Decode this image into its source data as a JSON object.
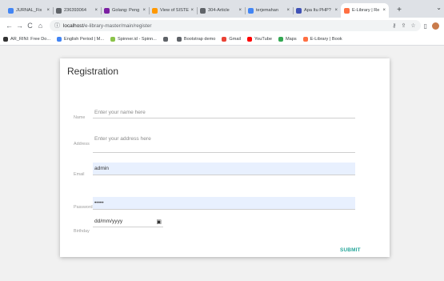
{
  "browser": {
    "tabs": [
      {
        "title": "JURNAL_Fix",
        "color": "#4285f4"
      },
      {
        "title": "236393064",
        "color": "#5f6368"
      },
      {
        "title": "Golang: Peng",
        "color": "#7b1fa2"
      },
      {
        "title": "View of SISTE",
        "color": "#ff9800"
      },
      {
        "title": "304-Article",
        "color": "#5f6368"
      },
      {
        "title": "terjemahan",
        "color": "#4285f4"
      },
      {
        "title": "Apa Itu PHP?",
        "color": "#3f51b5"
      },
      {
        "title": "E-Library | Re",
        "color": "#ff7043",
        "active": true
      }
    ],
    "close_glyph": "×",
    "new_tab_glyph": "+",
    "tab_search_glyph": "⌄",
    "url_host": "localhost",
    "url_path": "/e-library-master/main/register",
    "nav": {
      "back": "←",
      "forward": "→",
      "reload": "C",
      "home": "⌂"
    },
    "omni_icons": {
      "info": "ⓘ",
      "key": "⚷",
      "share": "⇪",
      "star": "☆"
    },
    "toolbar_icons": {
      "sidebar": "▯"
    },
    "bookmarks": [
      {
        "title": "AR_RINI: Free Do...",
        "color": "#333333"
      },
      {
        "title": "English Period | M...",
        "color": "#4285f4"
      },
      {
        "title": "Spinner.id - Spinn...",
        "color": "#8bc34a"
      },
      {
        "title": "",
        "color": "#5f6368"
      },
      {
        "title": "Bootstrap demo",
        "color": "#5f6368"
      },
      {
        "title": "Gmail",
        "color": "#ea4335"
      },
      {
        "title": "YouTube",
        "color": "#ff0000"
      },
      {
        "title": "Maps",
        "color": "#34a853"
      },
      {
        "title": "E-Library | Book",
        "color": "#ff7043"
      }
    ]
  },
  "form": {
    "title": "Registration",
    "name": {
      "label": "Name",
      "placeholder": "Enter your name here"
    },
    "address": {
      "label": "Address",
      "placeholder": "Enter your address here"
    },
    "email": {
      "label": "Email",
      "value": "admin"
    },
    "password": {
      "label": "Password",
      "value": "•••••"
    },
    "birthday": {
      "label": "Birthday",
      "value": "dd/mm/yyyy",
      "icon": "▣"
    },
    "submit_label": "SUBMIT"
  }
}
